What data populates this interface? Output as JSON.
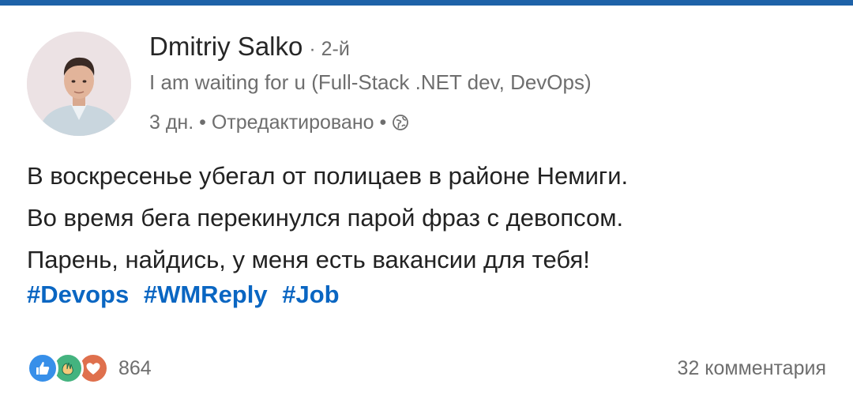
{
  "author": {
    "name": "Dmitriy Salko",
    "degree": "· 2-й",
    "headline": "I am waiting for u (Full-Stack .NET dev, DevOps)",
    "time": "3 дн. • Отредактировано •"
  },
  "post": {
    "lines": [
      "В воскресенье убегал от полицаев в районе Немиги.",
      "Во время бега перекинулся парой фраз с девопсом.",
      "Парень, найдись, у меня есть вакансии для тебя!"
    ],
    "hashtags": [
      "#Devops",
      "#WMReply",
      "#Job"
    ]
  },
  "social": {
    "reactions": [
      "like-icon",
      "celebrate-icon",
      "love-icon"
    ],
    "reaction_count": "864",
    "comments": "32 комментария"
  },
  "colors": {
    "accent": "#0a66c2",
    "topbar": "#1e62a8",
    "like": "#378fe9",
    "celebrate": "#44b37f",
    "love": "#df704d"
  }
}
